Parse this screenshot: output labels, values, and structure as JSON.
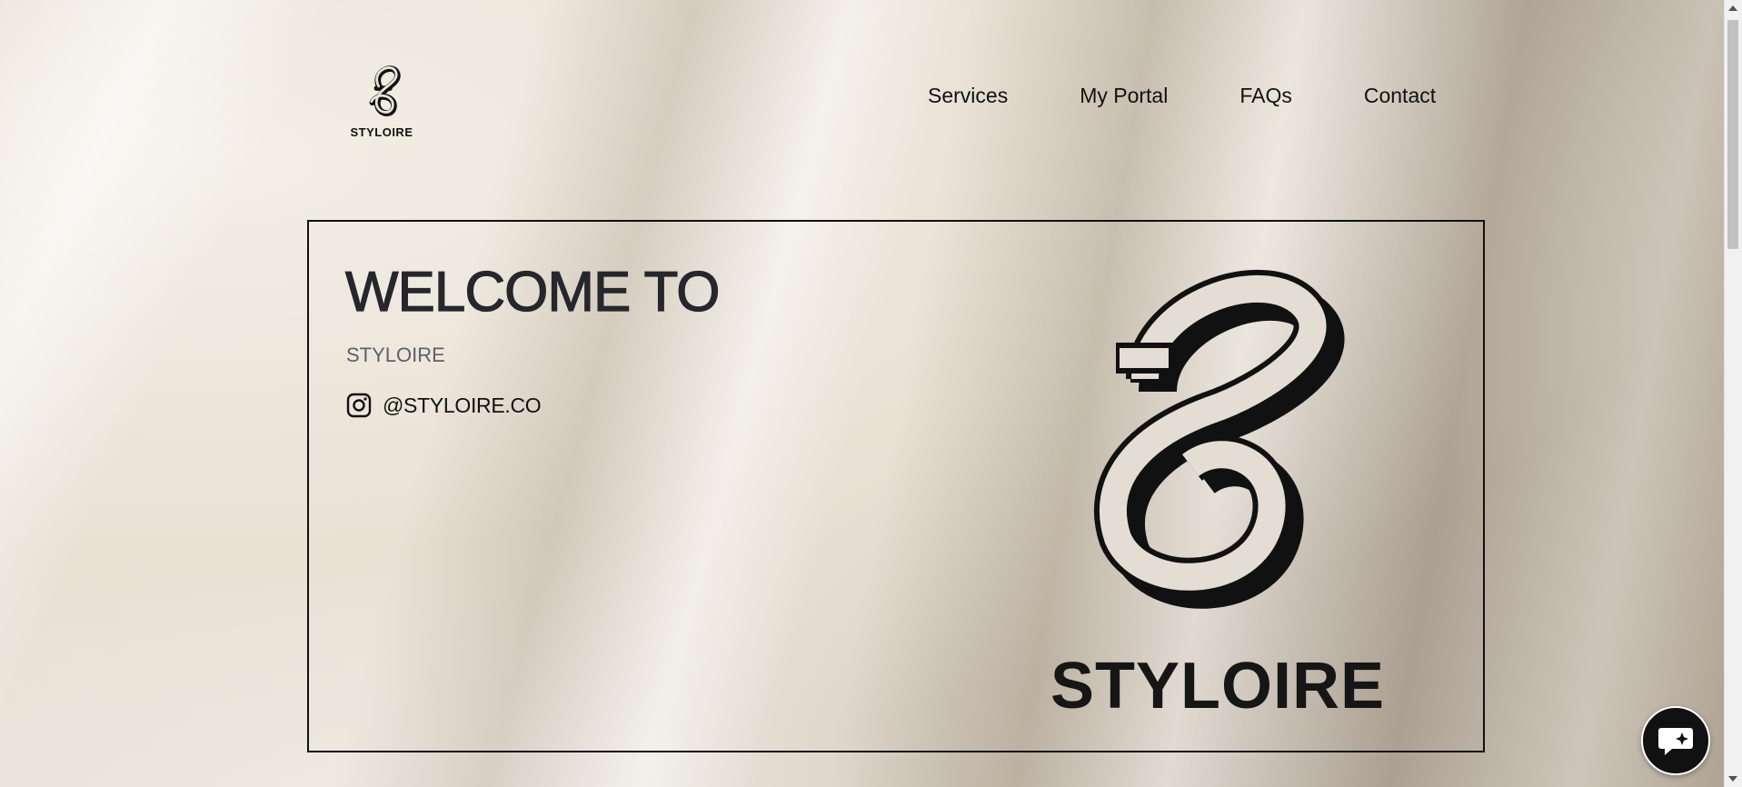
{
  "header": {
    "logo_text": "STYLOIRE",
    "nav": [
      {
        "label": "Services"
      },
      {
        "label": "My Portal"
      },
      {
        "label": "FAQs"
      },
      {
        "label": "Contact"
      }
    ]
  },
  "hero": {
    "title": "WELCOME TO",
    "subtitle": "STYLOIRE",
    "instagram_handle": "@STYLOIRE.CO",
    "brand_name": "STYLOIRE"
  },
  "icons": {
    "instagram": "instagram-icon",
    "chat": "chat-icon",
    "logo": "styloire-s-logo"
  },
  "colors": {
    "text_dark": "#26272c",
    "text_muted": "#5e6068",
    "chat_bg": "#111111"
  }
}
